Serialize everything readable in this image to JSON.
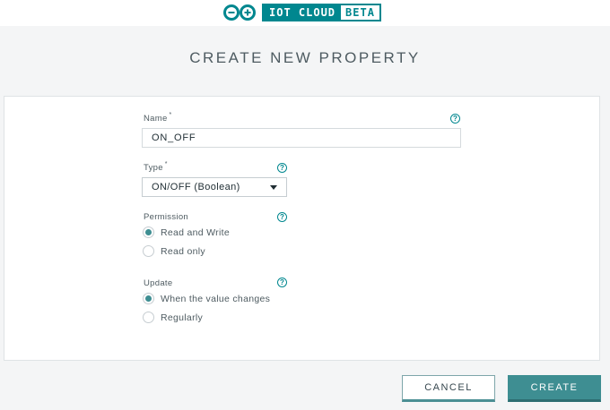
{
  "brand": {
    "logo_icon": "arduino-infinity-icon",
    "name": "IOT CLOUD",
    "badge": "BETA",
    "accent_color": "#00878f"
  },
  "title": "CREATE NEW PROPERTY",
  "form": {
    "name": {
      "label": "Name",
      "required_mark": "*",
      "value": "ON_OFF",
      "help_icon": "help-icon"
    },
    "type": {
      "label": "Type",
      "required_mark": "*",
      "selected": "ON/OFF (Boolean)",
      "help_icon": "help-icon"
    },
    "permission": {
      "label": "Permission",
      "options": [
        {
          "label": "Read and Write",
          "checked": true
        },
        {
          "label": "Read only",
          "checked": false
        }
      ]
    },
    "update": {
      "label": "Update",
      "options": [
        {
          "label": "When the value changes",
          "checked": true
        },
        {
          "label": "Regularly",
          "checked": false
        }
      ]
    }
  },
  "actions": {
    "cancel_label": "CANCEL",
    "create_label": "CREATE",
    "primary_color": "#3e8e92"
  }
}
